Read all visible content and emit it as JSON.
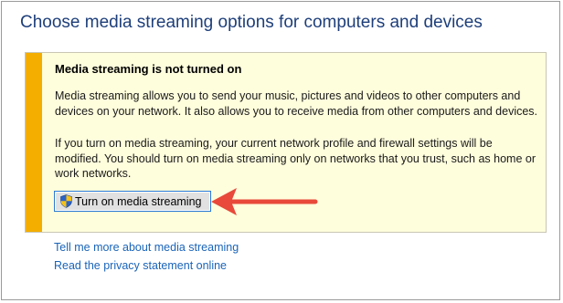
{
  "page": {
    "title": "Choose media streaming options for computers and devices"
  },
  "notice": {
    "heading": "Media streaming is not turned on",
    "paragraph1": "Media streaming allows you to send your music, pictures and videos to other computers and devices on your network.  It also allows you to receive media from other computers and devices.",
    "paragraph2": "If you turn on media streaming, your current network profile and firewall settings will be modified. You should turn on media streaming only on networks that you trust, such as home or work networks.",
    "button_label": "Turn on media streaming",
    "button_icon": "uac-shield-icon"
  },
  "links": {
    "more_info": "Tell me more about media streaming",
    "privacy": "Read the privacy statement online"
  },
  "annotation": {
    "arrow_icon": "red-arrow-icon",
    "arrow_color": "#e8493a"
  },
  "colors": {
    "title": "#1e3f7a",
    "panel_background": "#fefddc",
    "panel_stripe": "#f3ae00",
    "link": "#1a64b8"
  }
}
